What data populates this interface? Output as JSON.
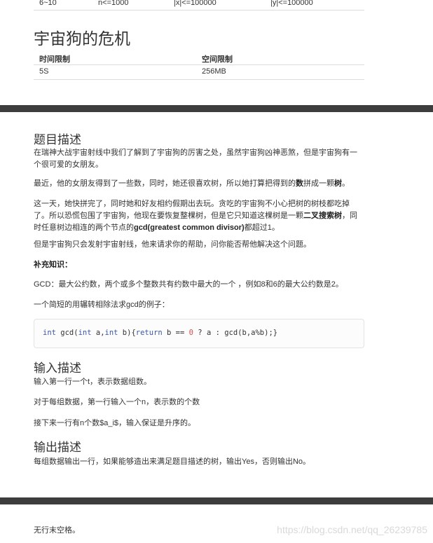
{
  "top_row": {
    "c1": "6~10",
    "c2": "n<=1000",
    "c3": "|x|<=100000",
    "c4": "|y|<=100000"
  },
  "problem_title": "宇宙狗的危机",
  "limits": {
    "time_header": "时间限制",
    "memory_header": "空间限制",
    "time_value": "5S",
    "memory_value": "256MB"
  },
  "description": {
    "heading": "题目描述",
    "p1": "在瑞神大战宇宙射线中我们了解到了宇宙狗的厉害之处，虽然宇宙狗凶神恶煞，但是宇宙狗有一个很可爱的女朋友。",
    "p2_a": "最近，他的女朋友得到了一些数，同时，她还很喜欢树，所以她打算把得到的",
    "p2_b1": "数",
    "p2_c": "拼成一颗",
    "p2_b2": "树",
    "p2_d": "。",
    "p3_a": "这一天，她快拼完了，同时她和好友相约假期出去玩。贪吃的宇宙狗不小心把树的树枝都吃掉了。所以恐慌包围了宇宙狗，他现在要恢复整棵树，但是它只知道这棵树是一颗",
    "p3_b1": "二叉搜索树",
    "p3_c": "，同时任意树边相连的两个节点的",
    "p3_b2": "gcd(greatest common divisor)",
    "p3_d": "都超过1。",
    "p4": "但是宇宙狗只会发射宇宙射线，他来请求你的帮助，问你能否帮他解决这个问题。",
    "supp_title": "补充知识：",
    "gcd_def": "GCD：最大公约数，两个或多个整数共有约数中最大的一个 ，例如8和6的最大公约数是2。",
    "example_intro": "一个简短的用辗转相除法求gcd的例子：",
    "code": {
      "t1": "int",
      "t2": " gcd(",
      "t3": "int",
      "t4": " a,",
      "t5": "int",
      "t6": " b){",
      "t7": "return",
      "t8": " b == ",
      "t9": "0",
      "t10": " ? a : gcd(b,a%b);}"
    }
  },
  "input": {
    "heading": "输入描述",
    "l1": "输入第一行一个t，表示数据组数。",
    "l2": "对于每组数据，第一行输入一个n，表示数的个数",
    "l3": "接下来一行有n个数$a_i$，输入保证是升序的。"
  },
  "output": {
    "heading": "输出描述",
    "l1": "每组数据输出一行，如果能够造出来满足题目描述的树，输出Yes，否则输出No。"
  },
  "footer_note": "无行末空格。",
  "watermark": "https://blog.csdn.net/qq_26239785"
}
